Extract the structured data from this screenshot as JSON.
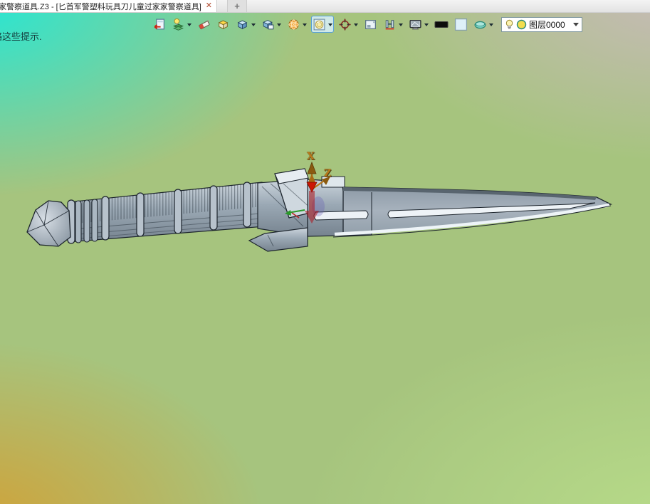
{
  "tab_bar": {
    "active_tab": {
      "title": "家警察道具.Z3 - [匕首军警塑料玩具刀儿童过家家警察道具]",
      "close_glyph": "✕"
    },
    "new_tab_glyph": "+"
  },
  "hint_text": "略这些提示.",
  "toolbar": {
    "icons": [
      {
        "name": "exit-environment-icon",
        "dropdown": false
      },
      {
        "name": "layer-visibility-icon",
        "dropdown": true
      },
      {
        "name": "eraser-icon",
        "dropdown": false
      },
      {
        "name": "solid-box-icon",
        "dropdown": false
      },
      {
        "name": "shaded-cube-icon",
        "dropdown": true
      },
      {
        "name": "shaded-edges-cube-icon",
        "dropdown": true
      },
      {
        "name": "wireframe-sphere-icon",
        "dropdown": true
      },
      {
        "name": "render-mode-icon",
        "dropdown": true,
        "active": true
      },
      {
        "name": "rotate-target-icon",
        "dropdown": true
      },
      {
        "name": "viewport-window-icon",
        "dropdown": false
      },
      {
        "name": "section-view-icon",
        "dropdown": true
      },
      {
        "name": "display-monitor-icon",
        "dropdown": true
      },
      {
        "name": "line-color-swatch",
        "dropdown": false
      },
      {
        "name": "background-color-swatch",
        "dropdown": false
      },
      {
        "name": "surface-lens-icon",
        "dropdown": true
      }
    ],
    "layer_selector": {
      "value": "图层0000",
      "icons": [
        "lightbulb-icon",
        "layer-color-circle-icon"
      ]
    }
  },
  "viewport": {
    "triad": {
      "x_label": "X",
      "z_label": "Z"
    },
    "model_name": "plastic-toy-dagger-3d-model"
  },
  "colors": {
    "bg-top-left": "#25e7d5",
    "bg-top-right": "#c7bab8",
    "bg-bottom-left": "#d0a238",
    "bg-bottom-right": "#b7db89",
    "bg-base": "#a6c47e",
    "accent-close": "#b14a2e",
    "triad-orange": "#b9791c",
    "triad-red": "#cc1705"
  }
}
